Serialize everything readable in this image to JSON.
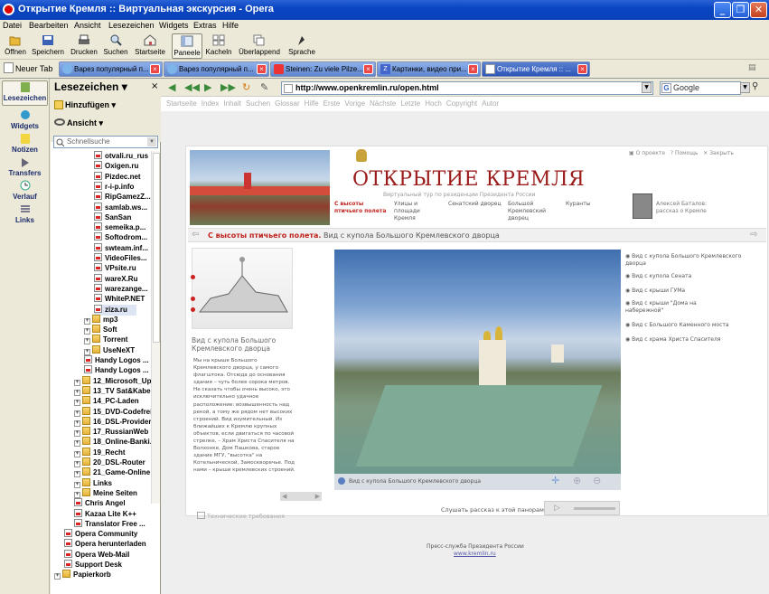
{
  "window": {
    "title": "Открытие Кремля :: Виртуальная экскурсия - Opera"
  },
  "menu": [
    "Datei",
    "Bearbeiten",
    "Ansicht",
    "Lesezeichen",
    "Widgets",
    "Extras",
    "Hilfe"
  ],
  "toolbar": [
    {
      "label": "Öffnen",
      "icon": "folder-open-icon"
    },
    {
      "label": "Speichern",
      "icon": "save-icon"
    },
    {
      "label": "Drucken",
      "icon": "print-icon"
    },
    {
      "label": "Suchen",
      "icon": "search-icon"
    },
    {
      "label": "Startseite",
      "icon": "home-icon"
    },
    {
      "label": "Paneele",
      "icon": "panels-icon"
    },
    {
      "label": "Kacheln",
      "icon": "tile-icon"
    },
    {
      "label": "Überlappend",
      "icon": "cascade-icon"
    },
    {
      "label": "Sprache",
      "icon": "speech-icon"
    }
  ],
  "tabs": {
    "new_tab": "Neuer Tab",
    "items": [
      {
        "label": "Варез популярный п..."
      },
      {
        "label": "Варез популярный п..."
      },
      {
        "label": "Steinen: Zu viele Pilze..."
      },
      {
        "label": "Картинки, видео при..."
      },
      {
        "label": "Открытие Кремля :: ..."
      }
    ]
  },
  "side_strip": [
    "Lesezeichen",
    "Widgets",
    "Notizen",
    "Transfers",
    "Verlauf",
    "Links"
  ],
  "panel": {
    "title": "Lesezeichen",
    "add": "Hinzufügen",
    "view": "Ansicht",
    "search_placeholder": "Schnellsuche",
    "items": [
      {
        "label": "otvali.ru_rus",
        "type": "bookmark",
        "indent": 4
      },
      {
        "label": "Oxigen.ru",
        "type": "bookmark",
        "indent": 4
      },
      {
        "label": "Pizdec.net",
        "type": "bookmark",
        "indent": 4
      },
      {
        "label": "r-i-p.info",
        "type": "bookmark",
        "indent": 4
      },
      {
        "label": "RipGamezZ...",
        "type": "bookmark",
        "indent": 4
      },
      {
        "label": "samlab.ws...",
        "type": "bookmark",
        "indent": 4
      },
      {
        "label": "SanSan",
        "type": "bookmark",
        "indent": 4
      },
      {
        "label": "semeika.p...",
        "type": "bookmark",
        "indent": 4
      },
      {
        "label": "Softodrom...",
        "type": "bookmark",
        "indent": 4
      },
      {
        "label": "swteam.inf...",
        "type": "bookmark",
        "indent": 4
      },
      {
        "label": "VideoFiles...",
        "type": "bookmark",
        "indent": 4
      },
      {
        "label": "VPsite.ru",
        "type": "bookmark",
        "indent": 4
      },
      {
        "label": "wareX.Ru",
        "type": "bookmark",
        "indent": 4
      },
      {
        "label": "warezange...",
        "type": "bookmark",
        "indent": 4
      },
      {
        "label": "WhiteP.NET",
        "type": "bookmark",
        "indent": 4
      },
      {
        "label": "ziza.ru",
        "type": "bookmark",
        "indent": 4,
        "selected": true
      },
      {
        "label": "mp3",
        "type": "folder",
        "indent": 3
      },
      {
        "label": "Soft",
        "type": "folder",
        "indent": 3
      },
      {
        "label": "Torrent",
        "type": "folder",
        "indent": 3
      },
      {
        "label": "UseNeXT",
        "type": "folder",
        "indent": 3
      },
      {
        "label": "Handy Logos ...",
        "type": "bookmark",
        "indent": 3
      },
      {
        "label": "Handy Logos ...",
        "type": "bookmark",
        "indent": 3
      },
      {
        "label": "12_Microsoft_Up...",
        "type": "folder",
        "indent": 2
      },
      {
        "label": "13_TV Sat&Kabel",
        "type": "folder",
        "indent": 2
      },
      {
        "label": "14_PC-Laden",
        "type": "folder",
        "indent": 2
      },
      {
        "label": "15_DVD-Codefrei",
        "type": "folder",
        "indent": 2
      },
      {
        "label": "16_DSL-Provider",
        "type": "folder",
        "indent": 2
      },
      {
        "label": "17_RussianWeb",
        "type": "folder",
        "indent": 2
      },
      {
        "label": "18_Online-Banki...",
        "type": "folder",
        "indent": 2
      },
      {
        "label": "19_Recht",
        "type": "folder",
        "indent": 2
      },
      {
        "label": "20_DSL-Router",
        "type": "folder",
        "indent": 2
      },
      {
        "label": "21_Game-Online",
        "type": "folder",
        "indent": 2
      },
      {
        "label": "Links",
        "type": "folder",
        "indent": 2
      },
      {
        "label": "Meine Seiten",
        "type": "folder",
        "indent": 2
      },
      {
        "label": "Chris Angel",
        "type": "bookmark",
        "indent": 2
      },
      {
        "label": "Kazaa Lite K++",
        "type": "bookmark",
        "indent": 2
      },
      {
        "label": "Translator  Free ...",
        "type": "bookmark",
        "indent": 2
      },
      {
        "label": "Opera Community",
        "type": "bookmark",
        "indent": 1
      },
      {
        "label": "Opera herunterladen",
        "type": "bookmark",
        "indent": 1
      },
      {
        "label": "Opera Web-Mail",
        "type": "bookmark",
        "indent": 1
      },
      {
        "label": "Support Desk",
        "type": "bookmark",
        "indent": 1
      },
      {
        "label": "Papierkorb",
        "type": "folder",
        "indent": 0
      }
    ]
  },
  "address": {
    "url": "http://www.openkremlin.ru/open.html",
    "search_engine": "Google"
  },
  "nav_links": [
    "Startseite",
    "Index",
    "Inhalt",
    "Suchen",
    "Glossar",
    "Hilfe",
    "Erste",
    "Vorige",
    "Nächste",
    "Letzte",
    "Hoch",
    "Copyright",
    "Autor"
  ],
  "site": {
    "logo": "ОТКРЫТИЕ КРЕМЛЯ",
    "tagline": "Виртуальный тур по резиденции Президента России",
    "top_links": [
      "О проекте",
      "Помощь",
      "Закрыть"
    ],
    "menu": [
      "С высоты птичьего полета",
      "Улицы и площади Кремля",
      "Сенатский дворец",
      "Большой Кремлевский дворец",
      "Куранты"
    ],
    "guide": "Алексей Баталов: рассказ о Кремле",
    "heading_bold": "С высоты птичьего полета.",
    "heading_rest": "Вид с купола Большого Кремлевского дворца",
    "side_title": "Вид с купола Большого Кремлевского дворца",
    "side_text": "Мы на крыше Большого Кремлевского дворца, у самого флагштока. Отсюда до основания здания – чуть более сорока метров. Не сказать чтобы очень высоко, это исключительно удачное расположение: возвышенность над рекой, а тому же рядом нет высоких строений. Вид изумительный. Из ближайших к Кремлю крупных объектов, если двигаться по часовой стрелке, – Храм Христа Спасителя на Волхонке, Дом Пашкова, старое здание МГУ, \"высотка\" на Котельнической, Замоскворечье. Под нами – крыши кремлевских строений.",
    "panorama_caption": "Вид с купола Большого Кремлевского дворца",
    "listen": "Слушать рассказ к этой панораме",
    "views": [
      "Вид с купола Большого Кремлевского дворца",
      "Вид с купола Сената",
      "Вид с крыши ГУМа",
      "Вид с крыши \"Дома на набережной\"",
      "Вид с Большого Каменного моста",
      "Вид с храма Христа Спасителя"
    ],
    "tech": "Технические требования",
    "footer1": "Пресс-служба Президента России",
    "footer2": "www.kremlin.ru"
  },
  "colors": {
    "title_blue": "#0a45c2",
    "site_red": "#9b1b1b",
    "menu_red": "#c0231f"
  }
}
